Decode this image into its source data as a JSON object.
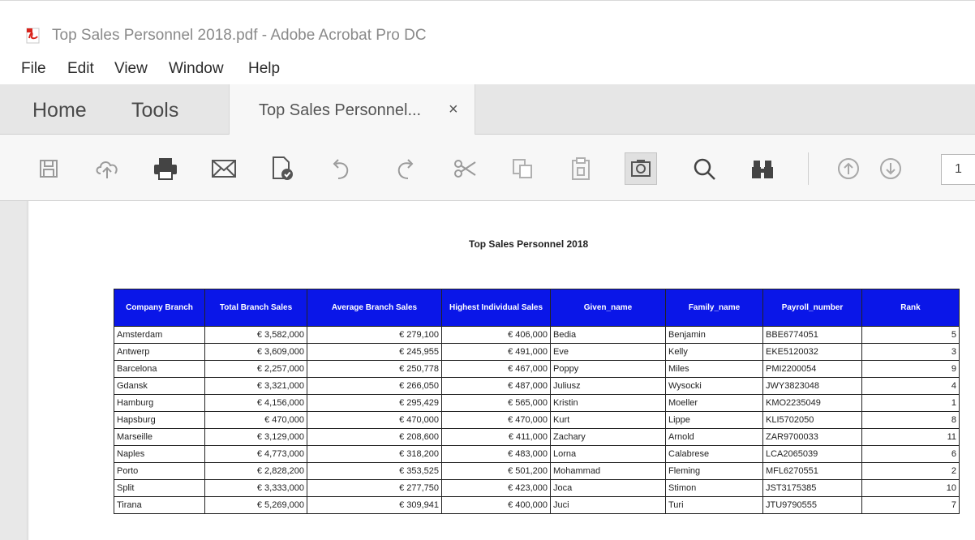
{
  "window": {
    "title": "Top Sales Personnel 2018.pdf - Adobe Acrobat Pro DC"
  },
  "menu": [
    "File",
    "Edit",
    "View",
    "Window",
    "Help"
  ],
  "tabs": {
    "home": "Home",
    "tools": "Tools",
    "document": "Top Sales Personnel...",
    "close_glyph": "×"
  },
  "toolbar": {
    "icons": [
      "save-icon",
      "upload-cloud-icon",
      "print-icon",
      "email-icon",
      "create-pdf-icon",
      "undo-icon",
      "redo-icon",
      "cut-icon",
      "copy-icon",
      "paste-icon",
      "snapshot-icon",
      "search-icon",
      "find-binoculars-icon",
      "previous-page-icon",
      "next-page-icon"
    ],
    "page_number": "1"
  },
  "document": {
    "title": "Top Sales Personnel 2018",
    "columns": [
      "Company Branch",
      "Total Branch Sales",
      "Average Branch Sales",
      "Highest Individual Sales",
      "Given_name",
      "Family_name",
      "Payroll_number",
      "Rank"
    ],
    "rows": [
      [
        "Amsterdam",
        "€ 3,582,000",
        "€ 279,100",
        "€ 406,000",
        "Bedia",
        "Benjamin",
        "BBE6774051",
        "5"
      ],
      [
        "Antwerp",
        "€ 3,609,000",
        "€ 245,955",
        "€ 491,000",
        "Eve",
        "Kelly",
        "EKE5120032",
        "3"
      ],
      [
        "Barcelona",
        "€ 2,257,000",
        "€ 250,778",
        "€ 467,000",
        "Poppy",
        "Miles",
        "PMI2200054",
        "9"
      ],
      [
        "Gdansk",
        "€ 3,321,000",
        "€ 266,050",
        "€ 487,000",
        "Juliusz",
        "Wysocki",
        "JWY3823048",
        "4"
      ],
      [
        "Hamburg",
        "€ 4,156,000",
        "€ 295,429",
        "€ 565,000",
        "Kristin",
        "Moeller",
        "KMO2235049",
        "1"
      ],
      [
        "Hapsburg",
        "€ 470,000",
        "€ 470,000",
        "€ 470,000",
        "Kurt",
        "Lippe",
        "KLI5702050",
        "8"
      ],
      [
        "Marseille",
        "€ 3,129,000",
        "€ 208,600",
        "€ 411,000",
        "Zachary",
        "Arnold",
        "ZAR9700033",
        "11"
      ],
      [
        "Naples",
        "€ 4,773,000",
        "€ 318,200",
        "€ 483,000",
        "Lorna",
        "Calabrese",
        "LCA2065039",
        "6"
      ],
      [
        "Porto",
        "€ 2,828,200",
        "€ 353,525",
        "€ 501,200",
        "Mohammad",
        "Fleming",
        "MFL6270551",
        "2"
      ],
      [
        "Split",
        "€ 3,333,000",
        "€ 277,750",
        "€ 423,000",
        "Joca",
        "Stimon",
        "JST3175385",
        "10"
      ],
      [
        "Tirana",
        "€ 5,269,000",
        "€ 309,941",
        "€ 400,000",
        "Juci",
        "Turi",
        "JTU9790555",
        "7"
      ]
    ]
  }
}
